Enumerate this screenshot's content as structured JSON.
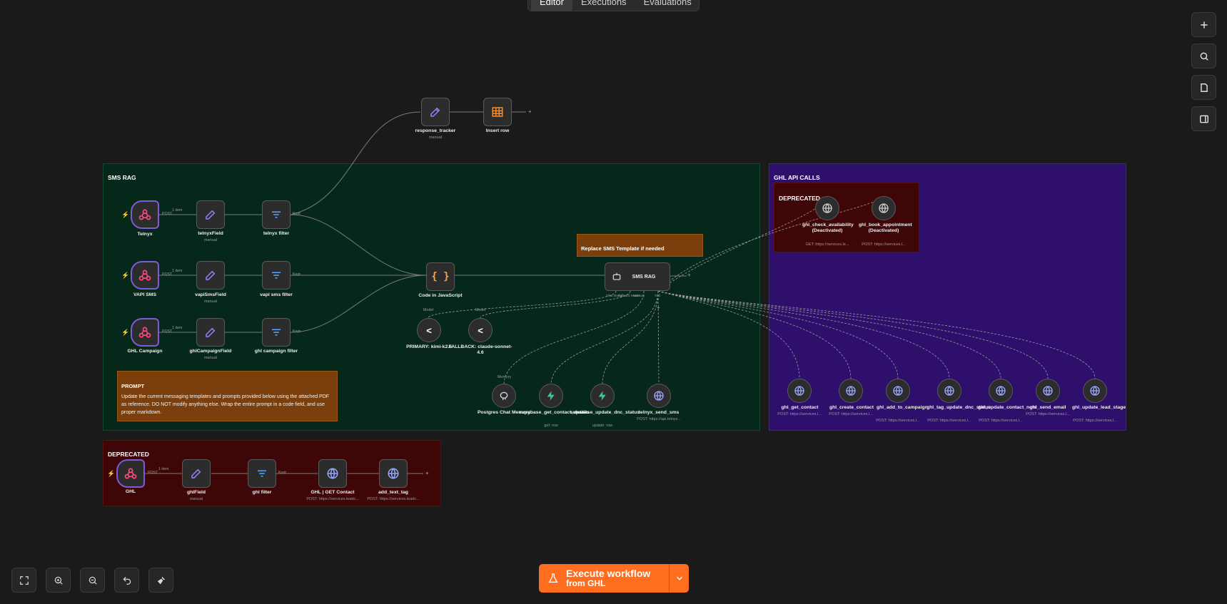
{
  "tabs": [
    "Editor",
    "Executions",
    "Evaluations"
  ],
  "top_nodes": {
    "response_tracker": {
      "label": "response_tracker",
      "sub": "manual"
    },
    "insert_row": {
      "label": "Insert row"
    }
  },
  "sms_rag": {
    "title": "SMS RAG",
    "row1": {
      "trigger": "Telnyx",
      "trigger_port": "POST",
      "count": "1 item",
      "edit": "telnyxField",
      "edit_sub": "manual",
      "filter": "telnyx filter",
      "filter_port": "Kept"
    },
    "row2": {
      "trigger": "VAPI SMS",
      "trigger_port": "POST",
      "count": "1 item",
      "edit": "vapiSmsField",
      "edit_sub": "manual",
      "filter": "vapi sms filter",
      "filter_port": "Kept"
    },
    "row3": {
      "trigger": "GHL Campaign",
      "trigger_port": "POST",
      "count": "1 item",
      "edit": "ghlCampaignField",
      "edit_sub": "manual",
      "filter": "ghl campaign filter",
      "filter_port": "Kept"
    },
    "code": "Code in JavaScript",
    "template_note": "Replace SMS Template if needed",
    "agent": {
      "label": "SMS RAG",
      "ports": [
        "Chat Model",
        "Fallback Model",
        "Memory",
        "Tool"
      ]
    },
    "models": [
      {
        "port": "Model",
        "label": "PRIMARY: kimi-k2.5"
      },
      {
        "port": "Model",
        "label": "FALLBACK: claude-sonnet-4.6"
      }
    ],
    "tools": [
      {
        "port": "Memory",
        "label": "Postgres Chat Memory",
        "sub": ""
      },
      {
        "label": "supabase_get_contact_details",
        "sub": "get: row"
      },
      {
        "label": "supabase_update_dnc_status",
        "sub": "update: row"
      },
      {
        "label": "telnyx_send_sms",
        "sub": "POST: https://api.telnyx..."
      }
    ],
    "prompt": {
      "title": "PROMPT",
      "body": "Update the current messaging templates and prompts provided below using the attached PDF as reference. DO NOT modify anything else. Wrap the entire prompt in a code field, and use proper markdown."
    }
  },
  "ghl_api": {
    "title": "GHL API CALLS",
    "deprecated_title": "DEPRECATED",
    "deprecated_nodes": [
      {
        "label": "ghl_check_availability (Deactivated)",
        "sub": "GET: https://services.le..."
      },
      {
        "label": "ghl_book_appointment (Deactivated)",
        "sub": "POST: https://services.l..."
      }
    ],
    "tools": [
      {
        "label": "ghl_get_contact",
        "sub": "POST: https://services.l..."
      },
      {
        "label": "ghl_create_contact",
        "sub": "POST: https://services.l..."
      },
      {
        "label": "ghl_add_to_campaign",
        "sub": "POST: https://services.l..."
      },
      {
        "label": "ghl_tag_update_dnc_status",
        "sub": "POST: https://services.l..."
      },
      {
        "label": "ghl_update_contact_note",
        "sub": "POST: https://services.l..."
      },
      {
        "label": "ghl_send_email",
        "sub": "POST: https://services.l..."
      },
      {
        "label": "ghl_update_lead_stage",
        "sub": "POST: https://services.l..."
      }
    ]
  },
  "deprecated_bottom": {
    "title": "DEPRECATED",
    "trigger": "GHL",
    "trigger_port": "POST",
    "count": "1 item",
    "edit": "ghlField",
    "edit_sub": "manual",
    "filter": "ghl filter",
    "filter_port": "Kept",
    "http1": "GHL | GET Contact",
    "http1_sub": "POST: https://services.leadc...",
    "http2": "add_text_tag",
    "http2_sub": "POST: https://services.leadc..."
  },
  "execute": {
    "line1": "Execute workflow",
    "line2": "from GHL"
  },
  "colors": {
    "sms_rag_bg": "#05281a",
    "ghl_bg": "#2e0f6b",
    "deprecated_bg": "#3e0606",
    "note_bg": "#7a3f0c",
    "accent": "#ff6d1f"
  }
}
